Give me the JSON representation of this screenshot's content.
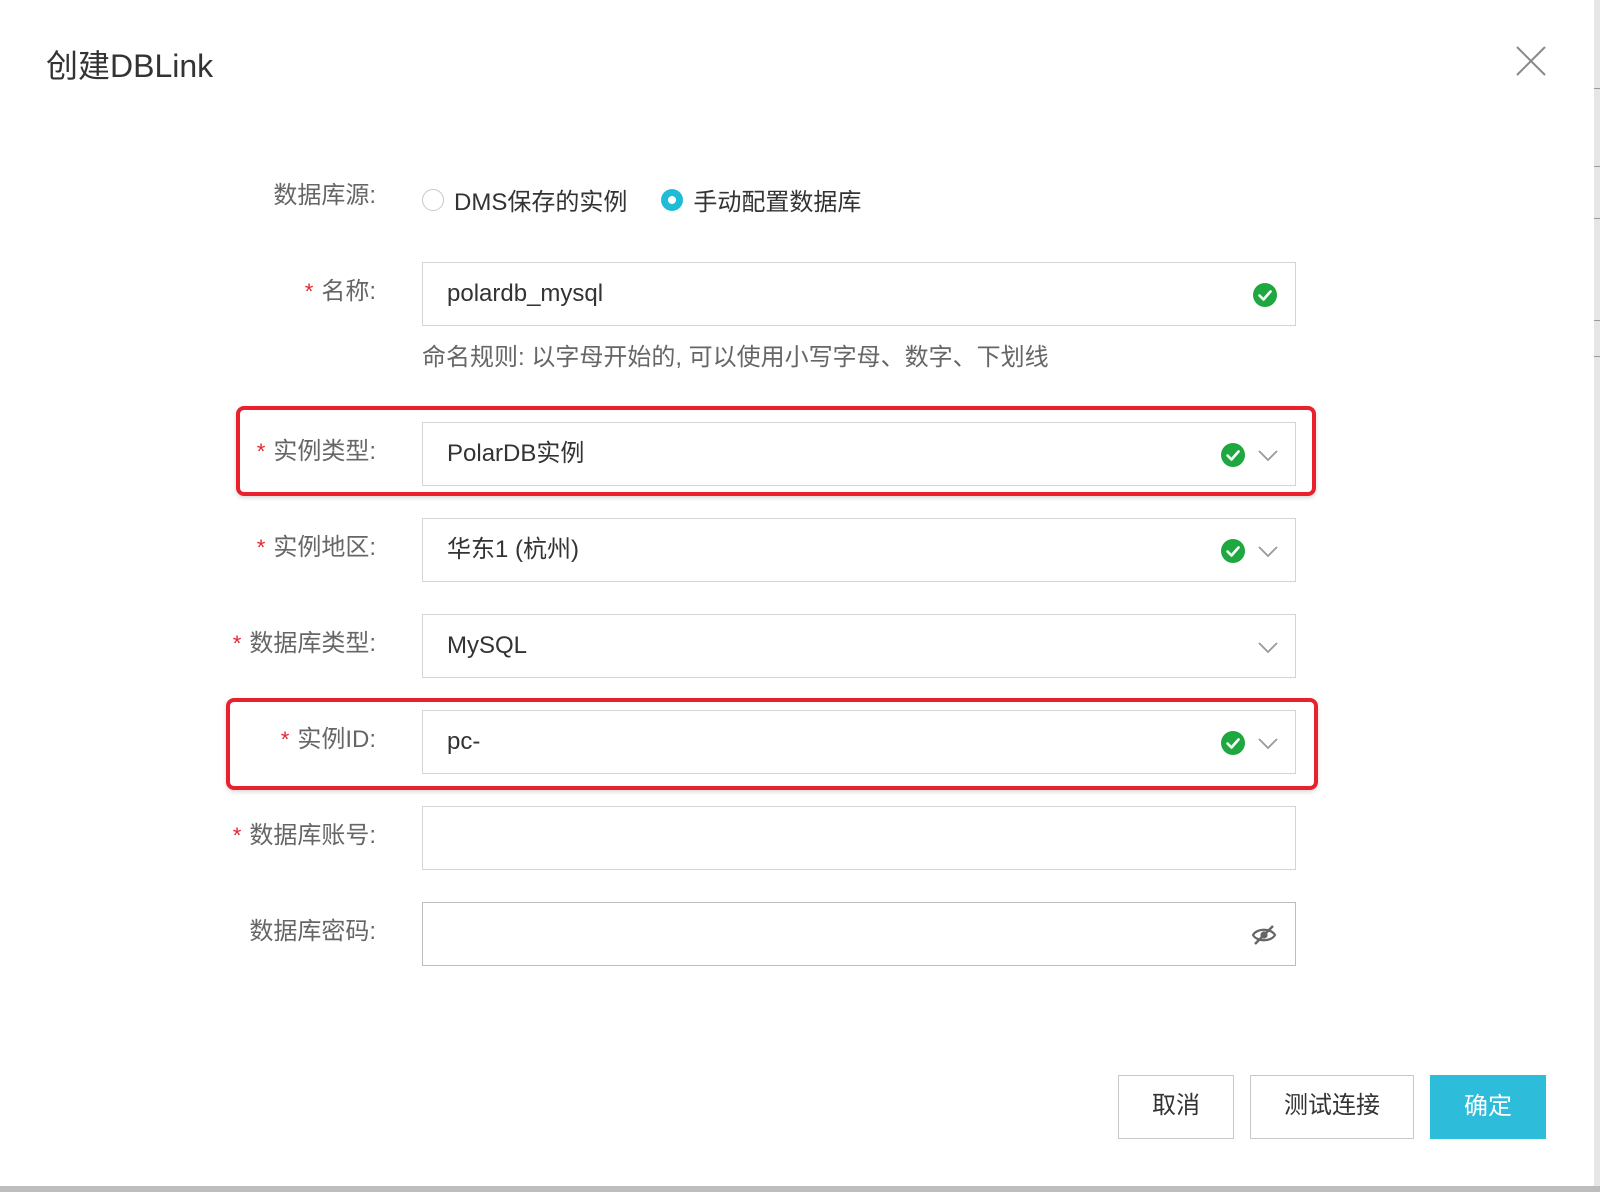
{
  "dialog": {
    "title": "创建DBLink"
  },
  "form": {
    "source": {
      "label": "数据库源:",
      "options": [
        "DMS保存的实例",
        "手动配置数据库"
      ],
      "selected_index": 1
    },
    "name": {
      "label": "名称:",
      "required": true,
      "value": "polardb_mysql",
      "status": "valid"
    },
    "naming_rule": "命名规则: 以字母开始的, 可以使用小写字母、数字、下划线",
    "instance_type": {
      "label": "实例类型:",
      "required": true,
      "value": "PolarDB实例",
      "status": "valid"
    },
    "instance_region": {
      "label": "实例地区:",
      "required": true,
      "value": "华东1 (杭州)",
      "status": "valid"
    },
    "db_type": {
      "label": "数据库类型:",
      "required": true,
      "value": "MySQL"
    },
    "instance_id": {
      "label": "实例ID:",
      "required": true,
      "value": "pc-",
      "status": "valid"
    },
    "db_account": {
      "label": "数据库账号:",
      "required": true,
      "value": ""
    },
    "db_password": {
      "label": "数据库密码:",
      "required": false,
      "value": ""
    }
  },
  "buttons": {
    "cancel": "取消",
    "test": "测试连接",
    "confirm": "确定"
  },
  "colors": {
    "accent": "#2dbcd9",
    "radio_accent": "#1fbcd6",
    "required": "#e0252c",
    "valid": "#1fa83f",
    "highlight": "#e8212c"
  },
  "icons": {
    "close": "close-icon",
    "valid": "check-circle-icon",
    "dropdown": "chevron-down-icon",
    "password_toggle": "eye-slash-icon"
  }
}
